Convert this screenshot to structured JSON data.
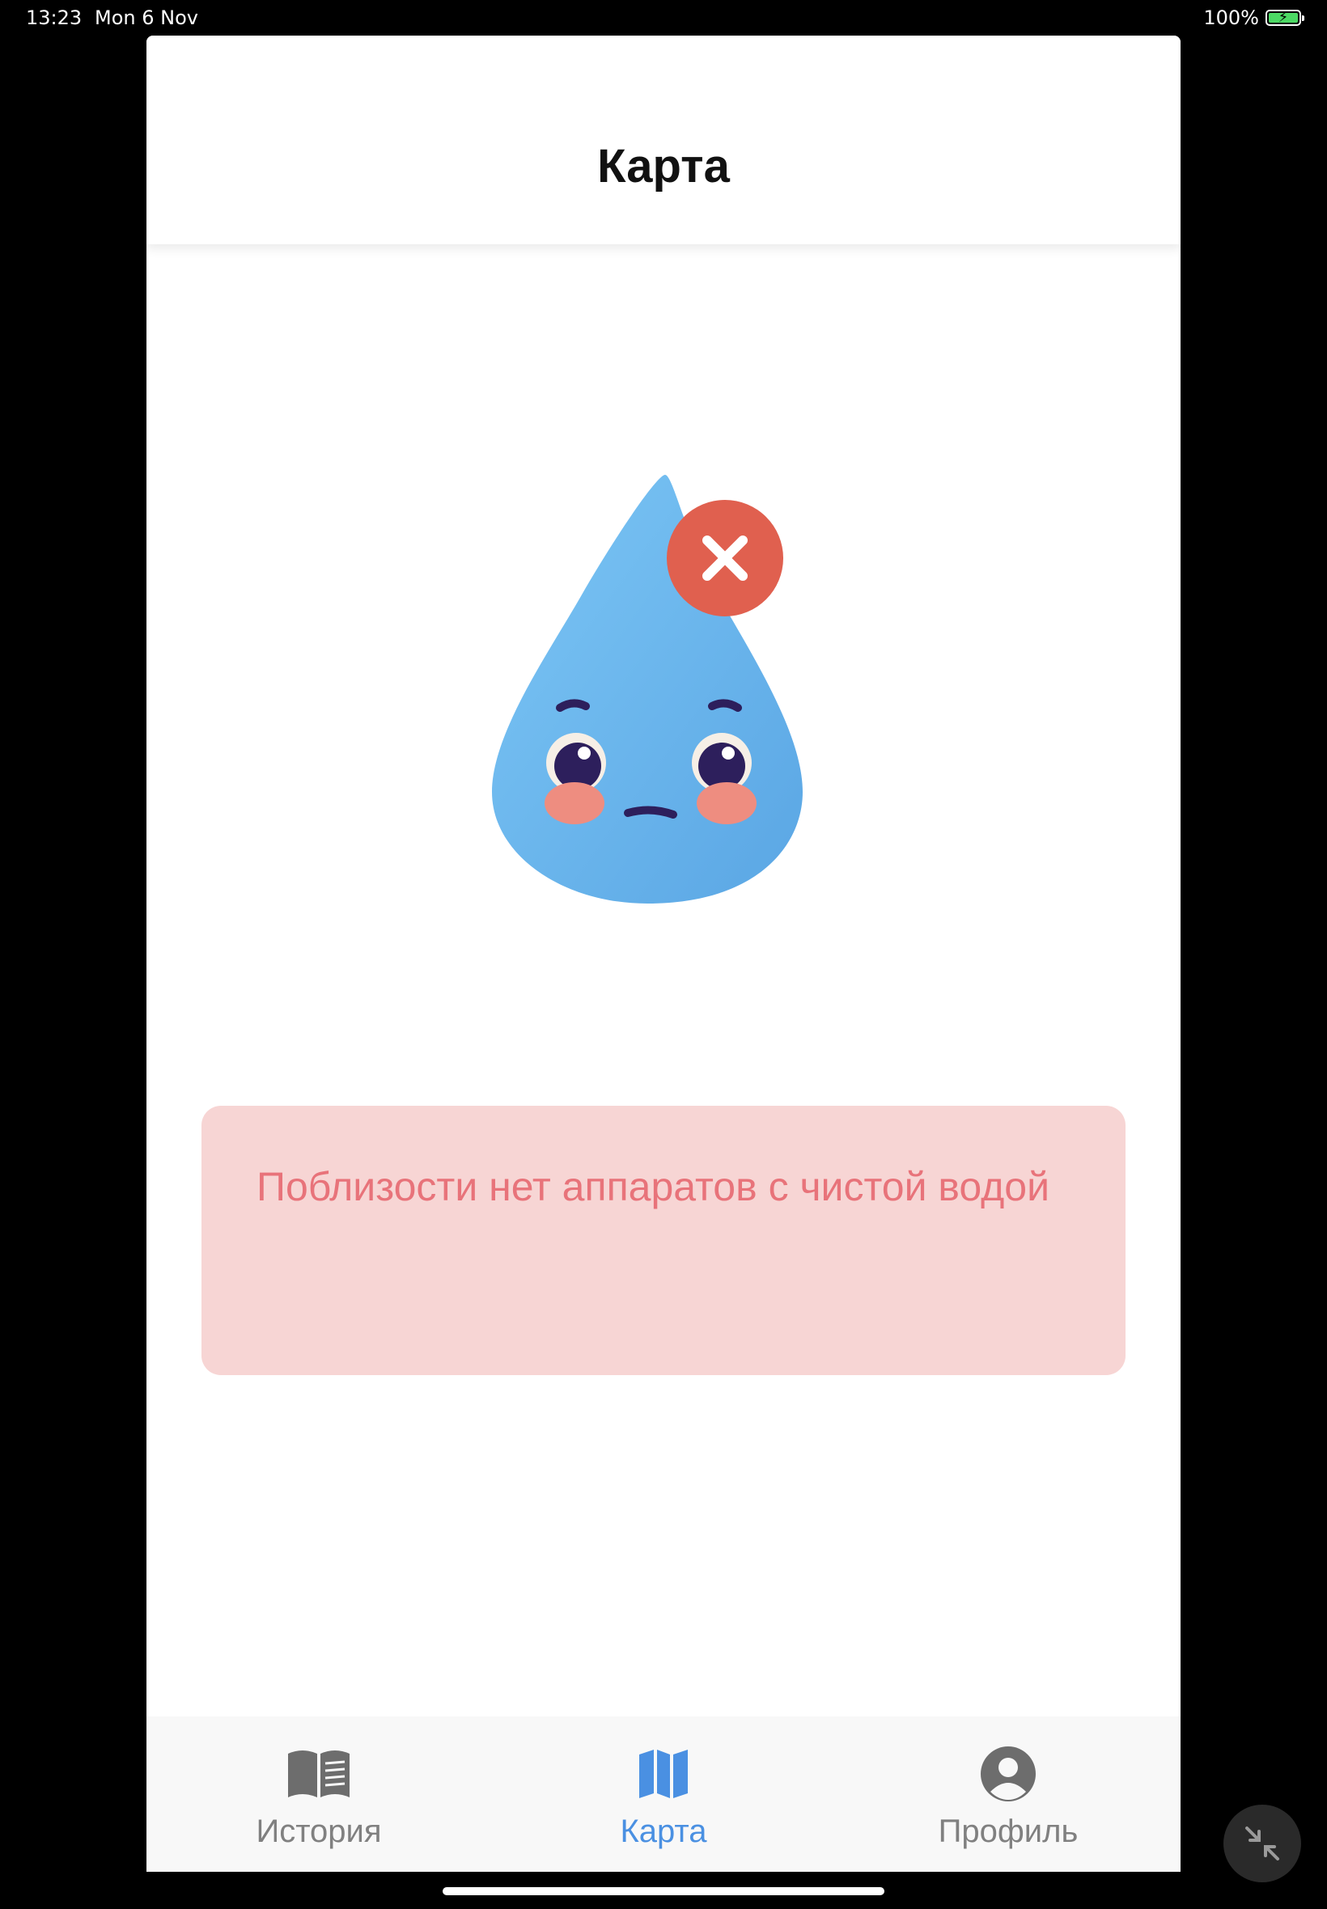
{
  "status_bar": {
    "time": "13:23",
    "date": "Mon 6 Nov",
    "battery": "100%",
    "battery_level": 1.0,
    "charging": true
  },
  "header": {
    "title": "Карта"
  },
  "mascot": {
    "icon": "sad-water-drop-icon",
    "badge_icon": "close-icon",
    "drop_color": "#6bb8ef",
    "badge_color": "#e0604f"
  },
  "alert": {
    "message": "Поблизости нет аппаратов с чистой водой",
    "background": "#f7d5d4",
    "text_color": "#e8737a"
  },
  "tabbar": {
    "active_color": "#4a90e2",
    "inactive_color": "#808080",
    "tabs": [
      {
        "label": "История",
        "icon": "book-icon",
        "active": false
      },
      {
        "label": "Карта",
        "icon": "map-icon",
        "active": true
      },
      {
        "label": "Профиль",
        "icon": "profile-icon",
        "active": false
      }
    ]
  },
  "floating_button": {
    "icon": "collapse-arrows-icon"
  }
}
